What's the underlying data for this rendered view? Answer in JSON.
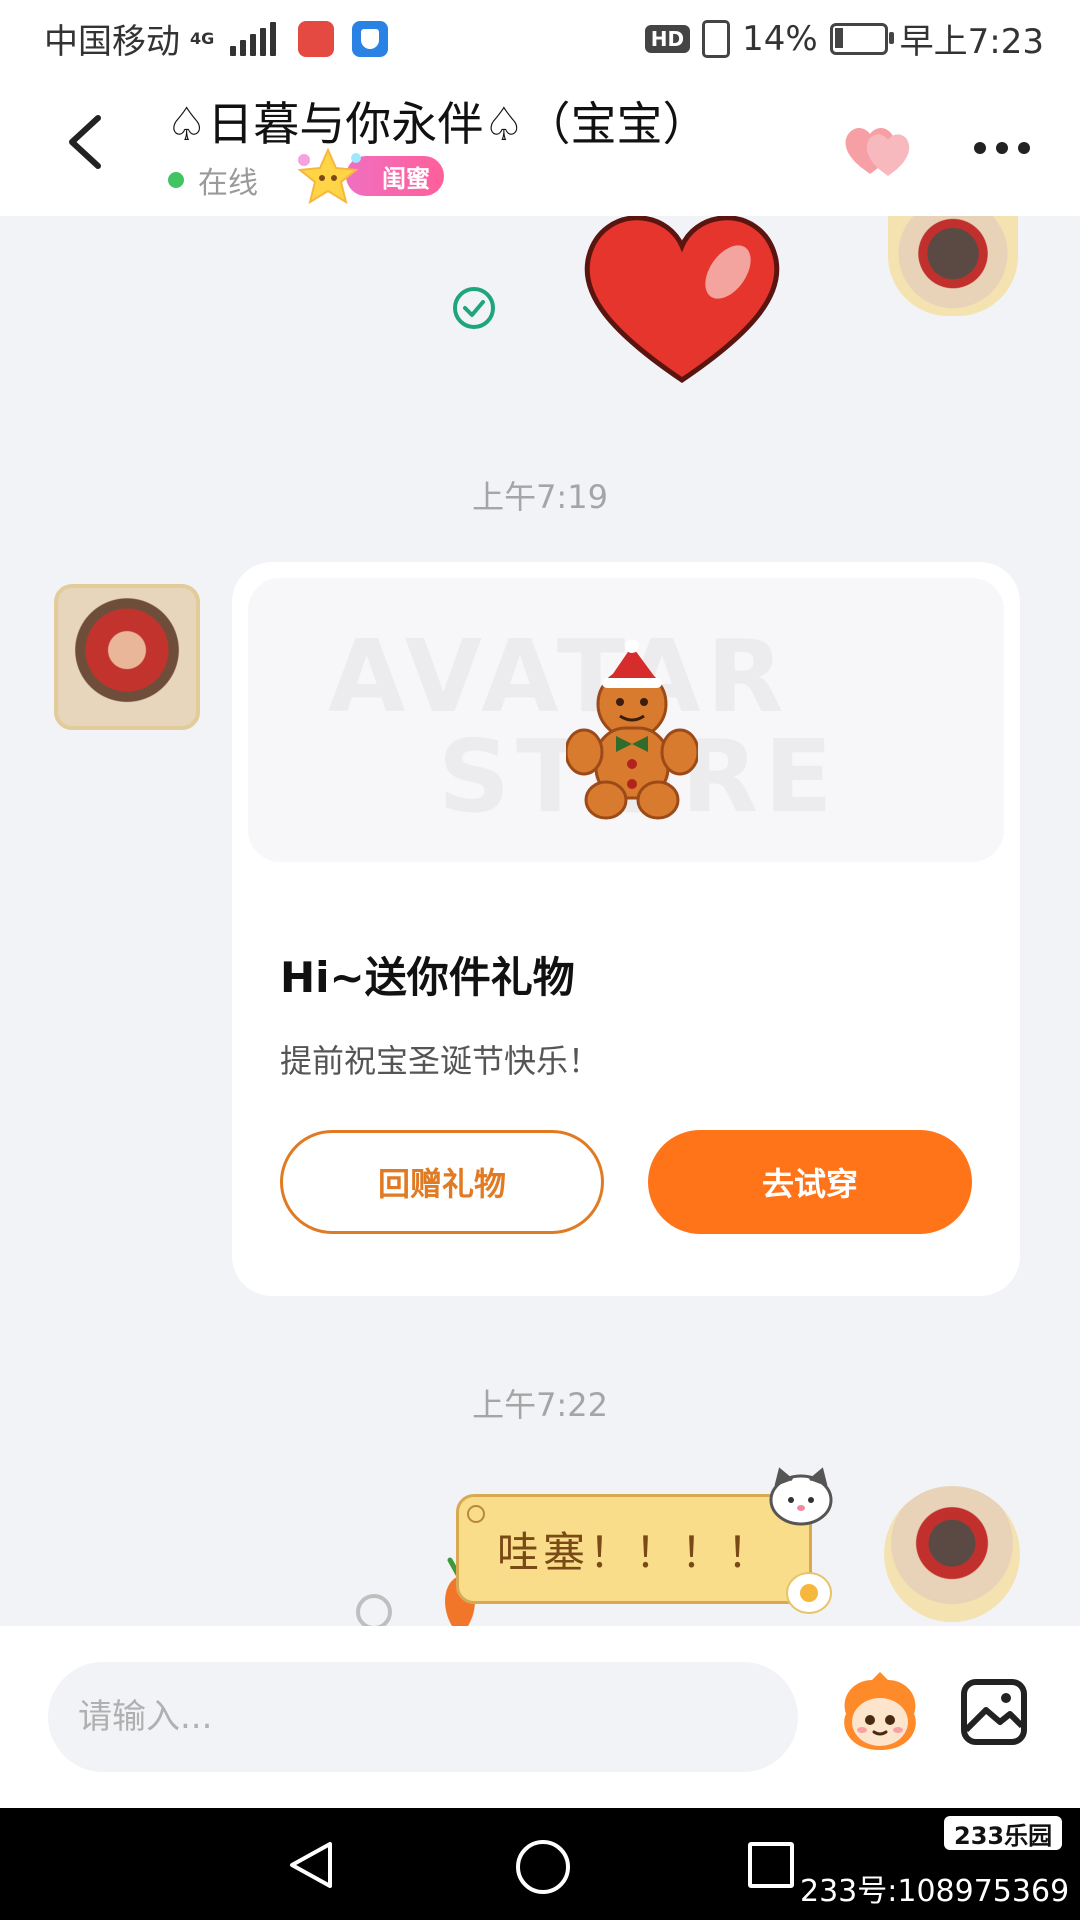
{
  "status_bar": {
    "carrier": "中国移动",
    "network": "4G",
    "hd": "HD",
    "battery": "14%",
    "time": "早上7:23"
  },
  "header": {
    "title": "♤日暮与你永伴♤（宝宝）",
    "status": "在线",
    "relation_badge": "闺蜜",
    "icons": {
      "back": "chevron-left-icon",
      "hearts": "double-heart-icon",
      "more": "more-dots-icon"
    }
  },
  "messages": {
    "ts1": "上午7:19",
    "gift": {
      "watermark_top": "AVATAR",
      "watermark_bottom": "STORE",
      "title": "Hi~送你件礼物",
      "subtitle": "提前祝宝圣诞节快乐！",
      "return_gift_label": "回赠礼物",
      "try_on_label": "去试穿"
    },
    "ts2": "上午7:22",
    "bubble_text": "哇塞！！！！"
  },
  "input": {
    "placeholder": "请输入..."
  },
  "watermark": {
    "logo": "233乐园",
    "id": "233号:108975369"
  },
  "colors": {
    "accent": "#ff7418",
    "online": "#43c463",
    "bubble": "#f9dd8a"
  }
}
